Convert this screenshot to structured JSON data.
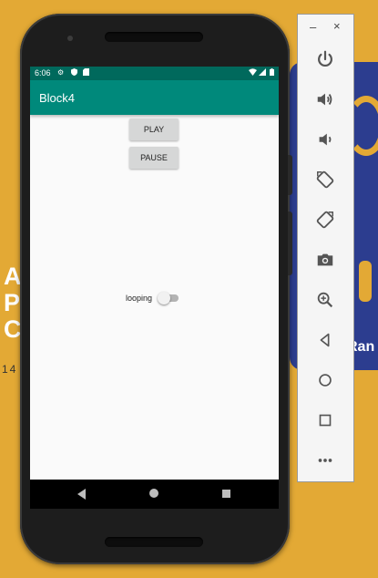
{
  "app": {
    "title": "Block4",
    "status_time": "6:06",
    "buttons": {
      "play": "PLAY",
      "pause": "PAUSE"
    },
    "looping": {
      "label": "looping",
      "checked": false
    }
  },
  "background": {
    "right_text": "Ran",
    "left_letters": [
      "A",
      "P",
      "C"
    ],
    "left_digits": "14"
  },
  "emulator_panel": {
    "window_minimize": "–",
    "window_close": "×",
    "tools": [
      "power-icon",
      "volume-up-icon",
      "volume-down-icon",
      "rotate-left-icon",
      "rotate-right-icon",
      "camera-icon",
      "zoom-icon",
      "back-icon",
      "home-icon",
      "overview-icon",
      "more-icon"
    ]
  },
  "colors": {
    "statusbar": "#00695c",
    "appbar": "#00897b",
    "desktop": "#e3a935",
    "accent_blue": "#2c3d8f"
  }
}
